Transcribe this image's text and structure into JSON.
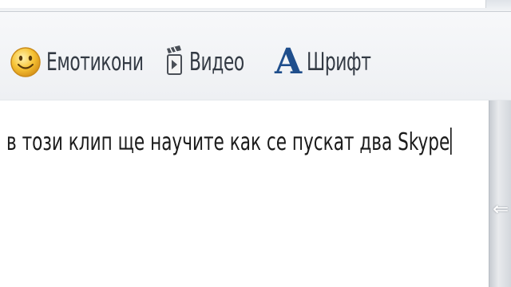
{
  "toolbar": {
    "emoticons_label": "Емотикони",
    "video_label": "Видео",
    "font_label": "Шрифт",
    "font_icon_glyph": "A"
  },
  "message": {
    "text": "в този клип ще научите как се пускат два Skype"
  },
  "scrollbar": {
    "arrow_glyph": "⇐"
  },
  "colors": {
    "font_icon": "#1f4e8c",
    "smiley_fill": "#f6c234",
    "toolbar_text": "#333a44"
  },
  "icons": [
    "smiley-icon",
    "video-clapper-icon",
    "font-a-icon",
    "arrow-left-icon"
  ]
}
